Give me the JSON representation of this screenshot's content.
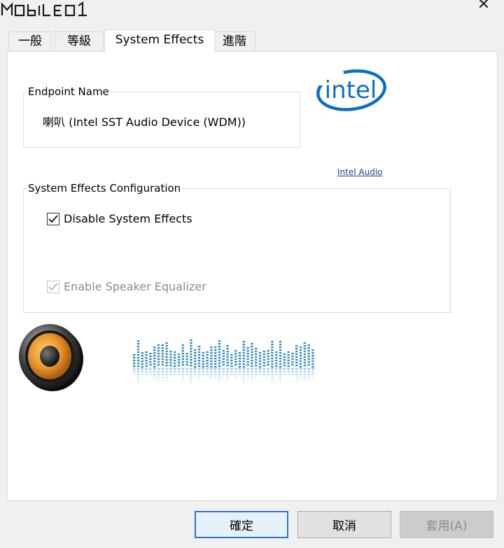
{
  "window": {
    "watermark_text": "MOBILE01",
    "close_symbol": "✕"
  },
  "tabs": [
    {
      "label": "一般",
      "active": false
    },
    {
      "label": "等級",
      "active": false
    },
    {
      "label": "System Effects",
      "active": true
    },
    {
      "label": "進階",
      "active": false
    }
  ],
  "endpoint": {
    "title": "Endpoint Name",
    "value": "喇叭 (Intel SST Audio Device (WDM))"
  },
  "branding": {
    "logo_text": "intel",
    "link_label": "Intel Audio",
    "brand_color": "#0f6fbf"
  },
  "effects": {
    "title": "System Effects Configuration",
    "disable_label": "Disable System Effects",
    "disable_checked": true,
    "equalizer_label": "Enable Speaker Equalizer",
    "equalizer_checked": true,
    "equalizer_enabled": false
  },
  "icons": {
    "speaker": "speaker-icon",
    "equalizer": "audio-waveform-graphic"
  },
  "footer": {
    "ok_label": "確定",
    "cancel_label": "取消",
    "apply_label": "套用(A)",
    "apply_enabled": false
  }
}
